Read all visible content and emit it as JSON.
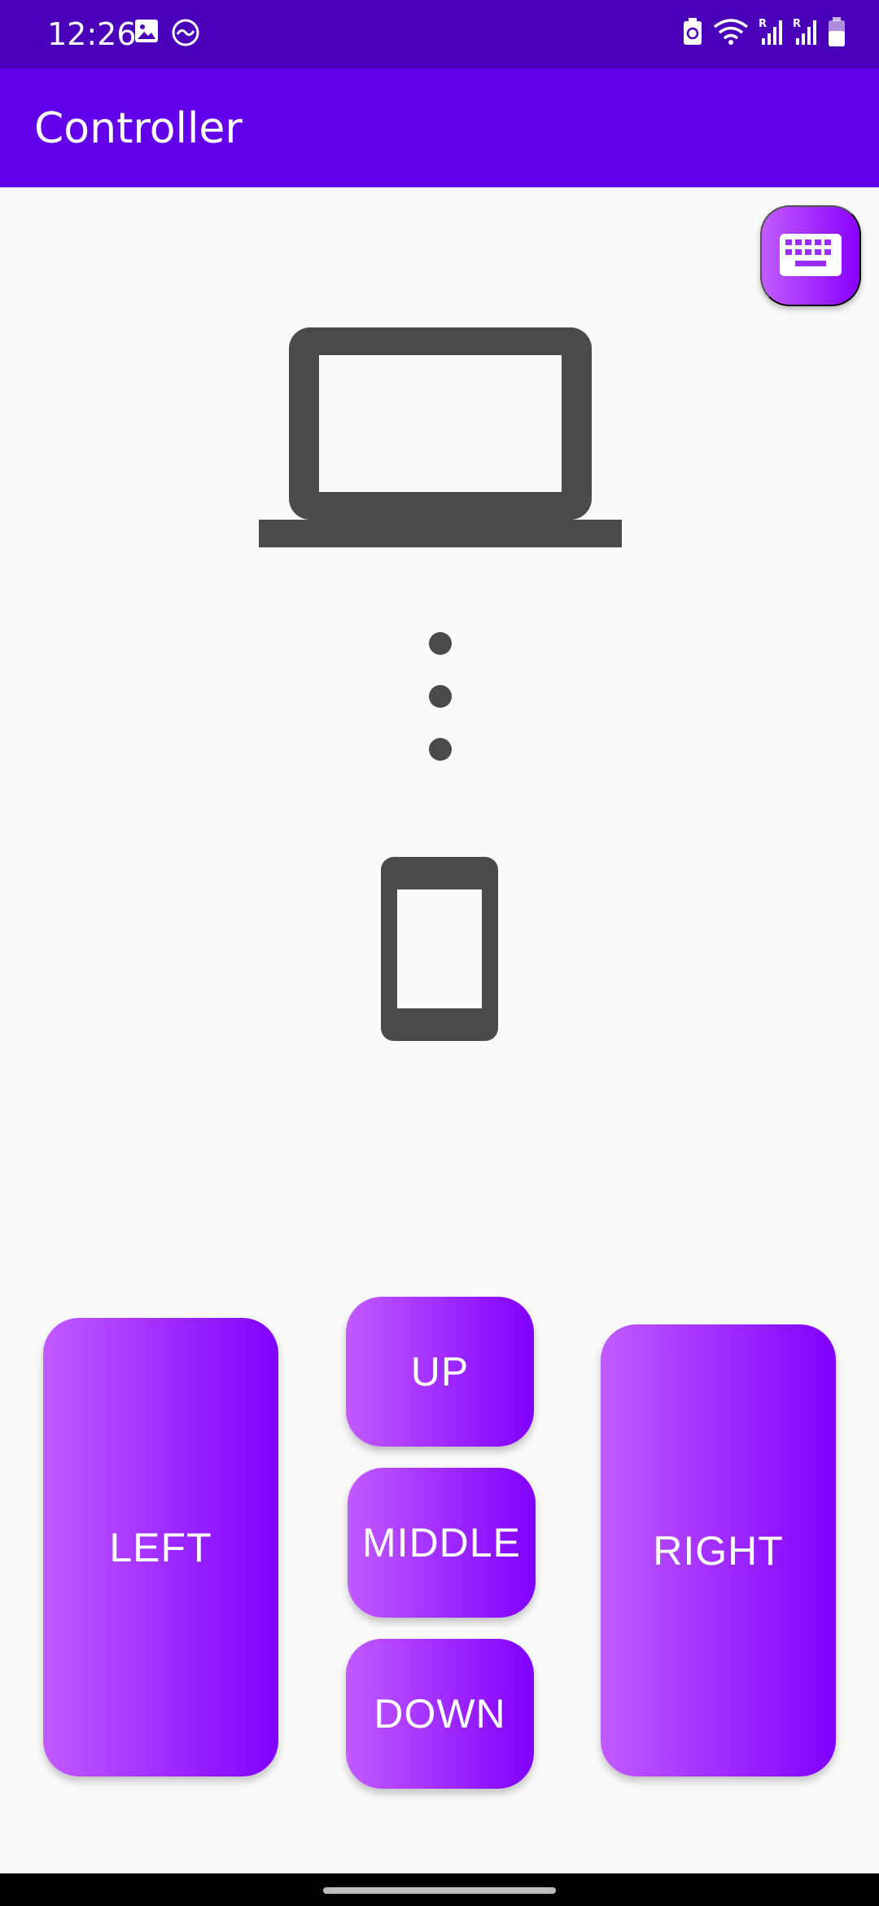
{
  "status_bar": {
    "time": "12:26",
    "left_icons": [
      "gallery-icon",
      "activity-icon"
    ],
    "right_icons": [
      "battery-saver-icon",
      "wifi-icon",
      "signal-r-icon",
      "signal-r-icon",
      "battery-icon"
    ],
    "background": "#4a00b8"
  },
  "app_bar": {
    "title": "Controller",
    "background": "#6200ea"
  },
  "fab": {
    "icon": "keyboard-icon"
  },
  "illustration": {
    "top": "laptop-icon",
    "middle": "vertical-dots-icon",
    "bottom": "phone-icon",
    "color": "#4a4a4a"
  },
  "buttons": {
    "left": "LEFT",
    "up": "UP",
    "middle": "MIDDLE",
    "down": "DOWN",
    "right": "RIGHT",
    "gradient_start": "#c25bff",
    "gradient_end": "#8000ff"
  }
}
